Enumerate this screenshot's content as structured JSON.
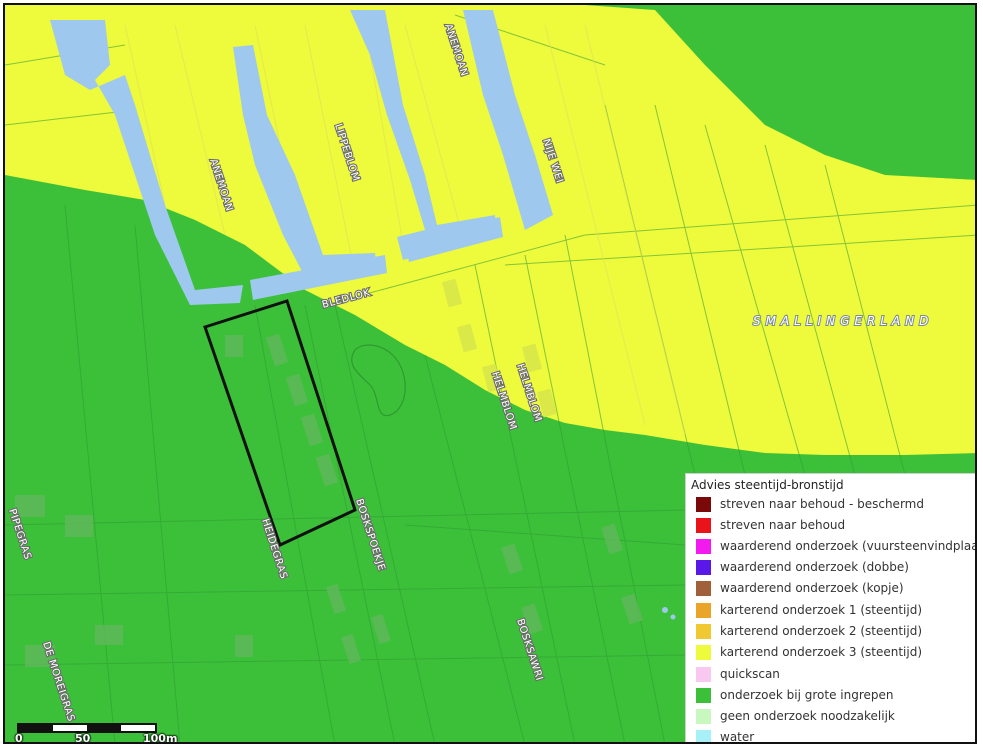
{
  "map": {
    "municipality_label": "SMALLINGERLAND",
    "street_labels": [
      {
        "id": "anemoan-top",
        "text": "ANEMOAN"
      },
      {
        "id": "lippeblom",
        "text": "LIPPEBLOM"
      },
      {
        "id": "nije-wei",
        "text": "NIJE WEI"
      },
      {
        "id": "anemoan-left",
        "text": "ANEMOAN"
      },
      {
        "id": "bledlok",
        "text": "BLEDLOK"
      },
      {
        "id": "helmblom-1",
        "text": "HELMBLOM"
      },
      {
        "id": "helmblom-2",
        "text": "HELMBLOM"
      },
      {
        "id": "heidegras",
        "text": "HEIDEGRAS"
      },
      {
        "id": "boskspoekje",
        "text": "BOSKSPOEKJE"
      },
      {
        "id": "bosksawri",
        "text": "BOSKSAWRI"
      },
      {
        "id": "pipegras",
        "text": "PIPEGRAS"
      },
      {
        "id": "de-moreigras",
        "text": "DE MOREIGRAS"
      }
    ],
    "colors": {
      "green": "#3cc03a",
      "yellow": "#eefa3c",
      "water": "#9ec8ee",
      "outline": "#111111"
    }
  },
  "legend": {
    "title": "Advies steentijd-bronstijd",
    "items": [
      {
        "label": "streven naar behoud - beschermd",
        "color": "#7a0a0a"
      },
      {
        "label": "streven naar behoud",
        "color": "#e8141a"
      },
      {
        "label": "waarderend onderzoek (vuursteenvindplaats)",
        "color": "#f21aef"
      },
      {
        "label": "waarderend onderzoek (dobbe)",
        "color": "#5a18e8"
      },
      {
        "label": "waarderend onderzoek (kopje)",
        "color": "#a0603a"
      },
      {
        "label": "karterend onderzoek 1 (steentijd)",
        "color": "#eaa42a"
      },
      {
        "label": "karterend onderzoek 2 (steentijd)",
        "color": "#f0c832"
      },
      {
        "label": "karterend onderzoek 3 (steentijd)",
        "color": "#eefa3c"
      },
      {
        "label": "quickscan",
        "color": "#f8c8f0"
      },
      {
        "label": "onderzoek bij grote ingrepen",
        "color": "#3cc03a"
      },
      {
        "label": "geen onderzoek noodzakelijk",
        "color": "#c8f8c0"
      },
      {
        "label": "water",
        "color": "#a8f0f8"
      }
    ]
  },
  "scale_bar": {
    "labels": [
      "0",
      "50",
      "100m"
    ]
  }
}
